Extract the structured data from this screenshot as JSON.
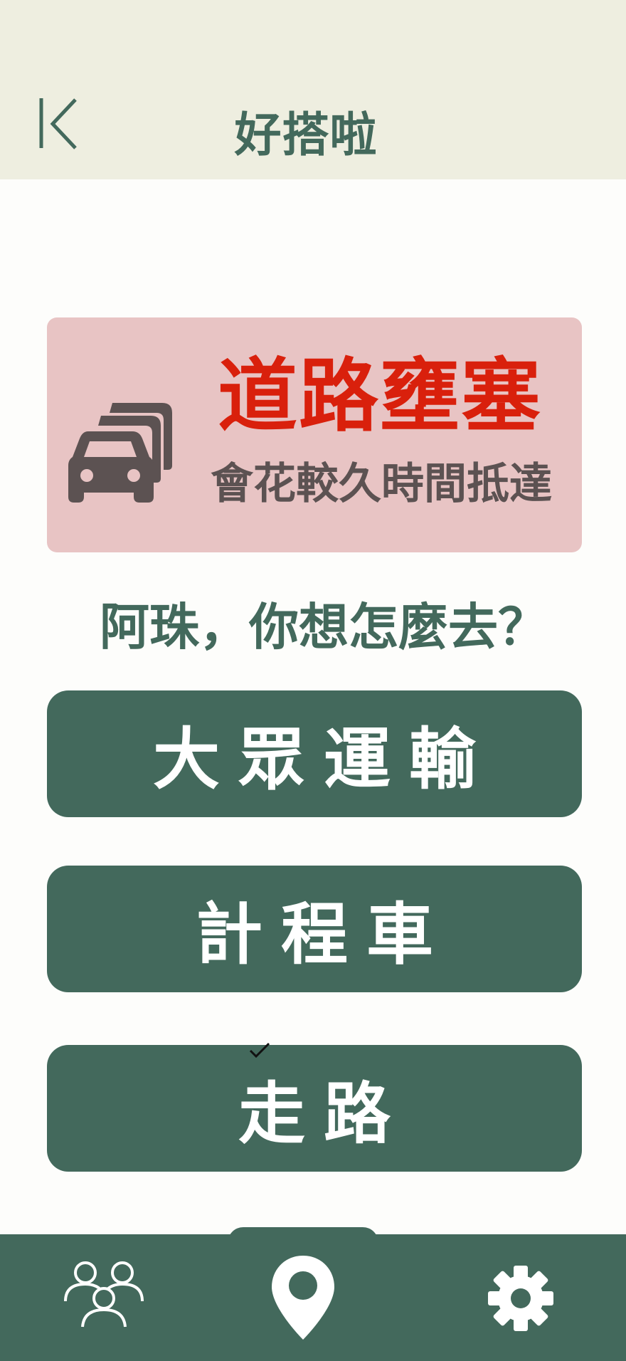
{
  "header": {
    "title": "好搭啦",
    "back_icon": "collapse-left-icon"
  },
  "alert": {
    "icon": "traffic-jam-car-icon",
    "title": "道路壅塞",
    "subtitle": "會花較久時間抵達",
    "title_color": "#d9200c",
    "background": "#e8c4c4"
  },
  "prompt": {
    "question": "阿珠，你想怎麼去？"
  },
  "choices": [
    {
      "label": "大眾運輸"
    },
    {
      "label": "計程車"
    },
    {
      "label": "走路",
      "selected": true
    }
  ],
  "nav": {
    "items": [
      {
        "icon": "people-icon"
      },
      {
        "icon": "map-pin-icon",
        "active": true
      },
      {
        "icon": "gear-icon"
      }
    ]
  },
  "colors": {
    "primary": "#43695c",
    "header_bg": "#eeeee0",
    "page_bg": "#fdfdfb"
  }
}
